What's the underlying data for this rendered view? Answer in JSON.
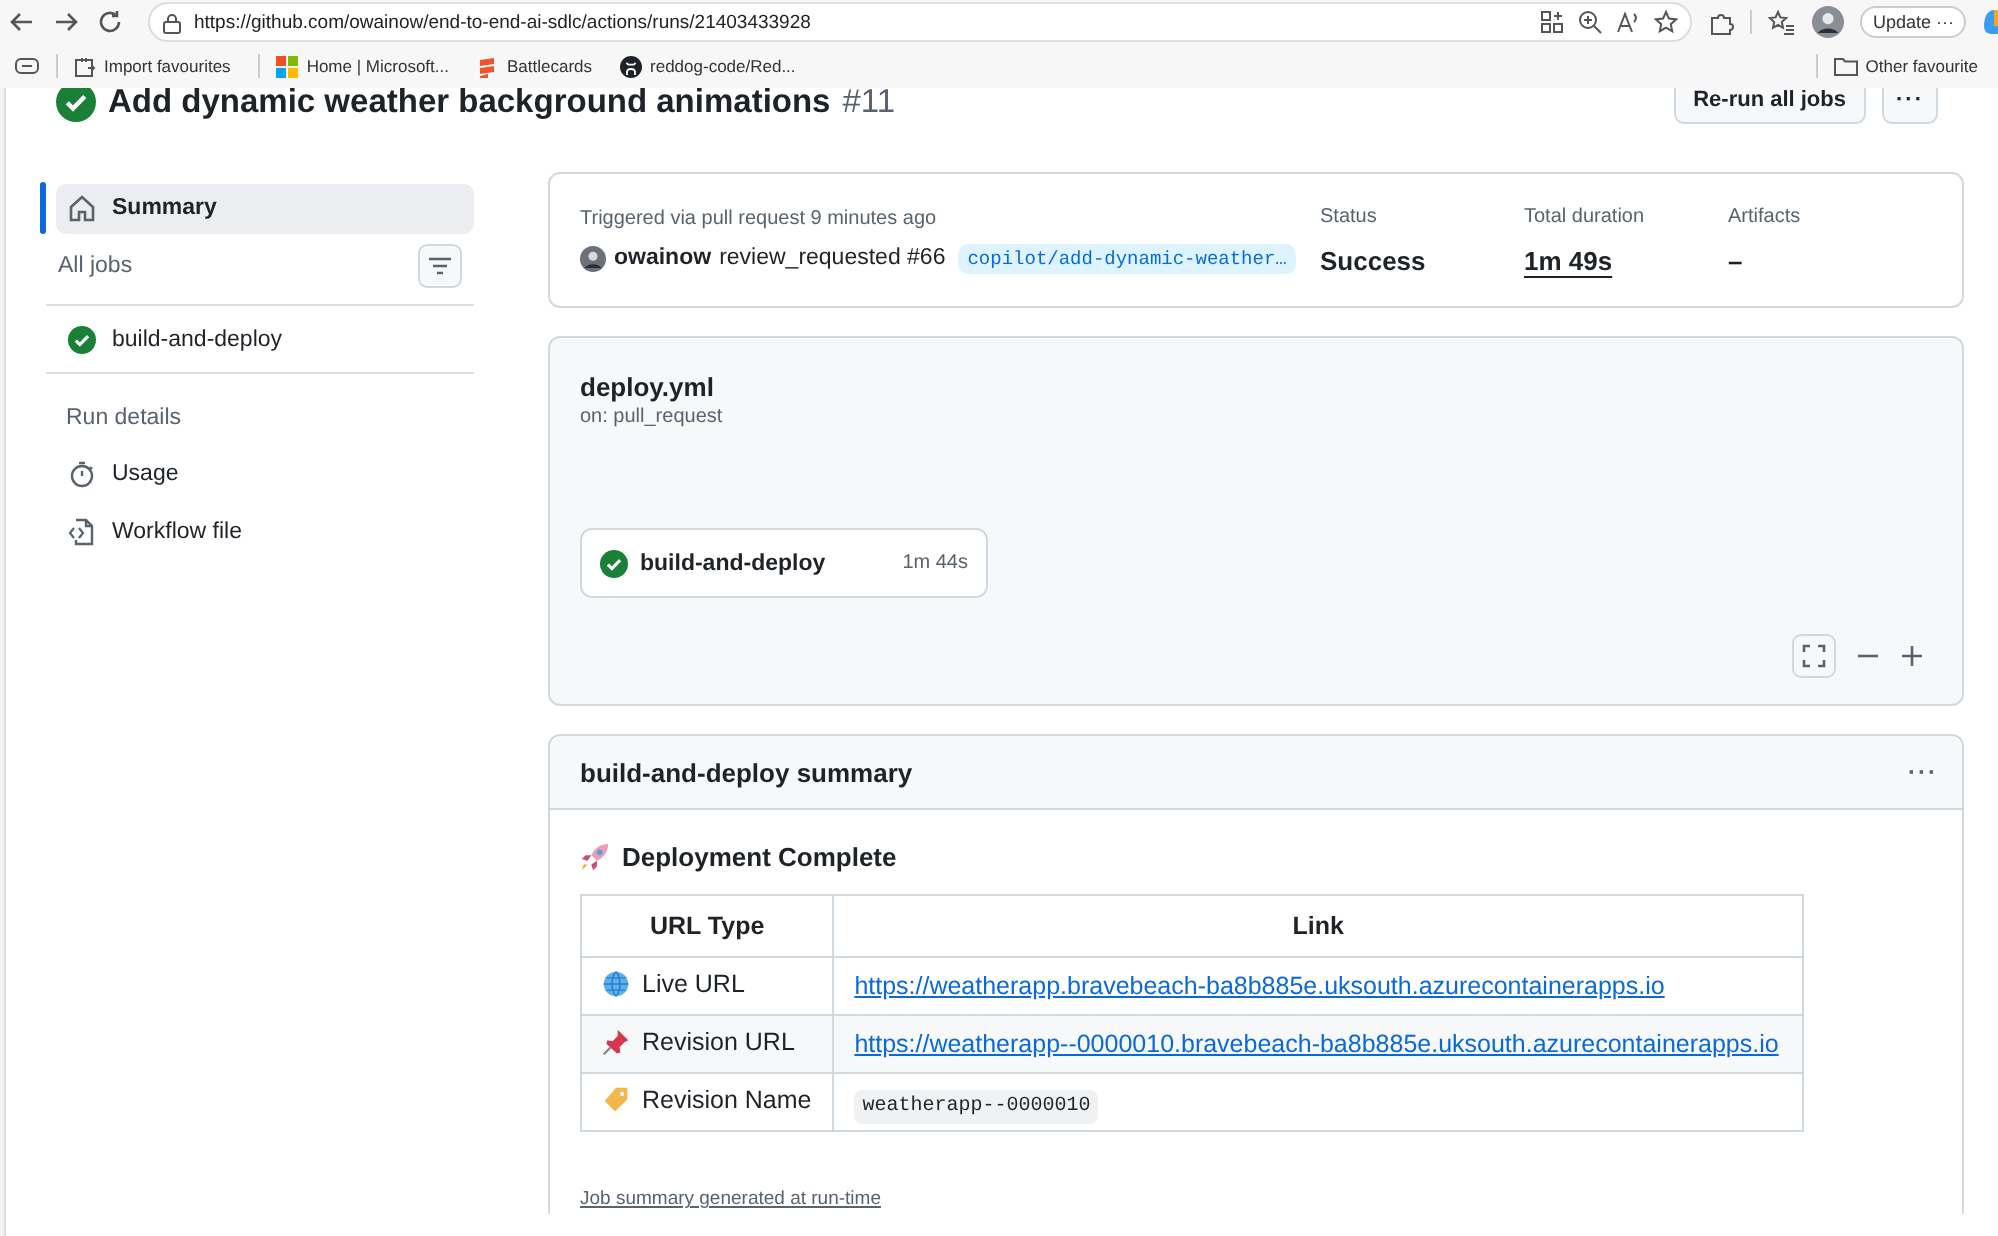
{
  "browser": {
    "url": "https://github.com/owainow/end-to-end-ai-sdlc/actions/runs/21403433928",
    "update_button": "Update ···",
    "bookmarks": [
      "Import favourites",
      "Home | Microsoft...",
      "Battlecards",
      "reddog-code/Red..."
    ],
    "other_favourites": "Other favourite"
  },
  "header": {
    "title": "Add dynamic weather background animations",
    "run_number": "#11",
    "rerun_button": "Re-run all jobs",
    "more_button": "···"
  },
  "sidebar": {
    "summary": {
      "label": "Summary",
      "selected": true
    },
    "all_jobs_label": "All jobs",
    "jobs": [
      {
        "label": "build-and-deploy",
        "selected": false
      }
    ],
    "run_details_label": "Run details",
    "details": [
      {
        "label": "Usage",
        "selected": false
      },
      {
        "label": "Workflow file",
        "selected": false
      }
    ]
  },
  "run_summary": {
    "trigger": "Triggered via pull request 9 minutes ago",
    "actor": "owainow",
    "event": "review_requested #66",
    "branch": "copilot/add-dynamic-weather…",
    "status_label": "Status",
    "status": "Success",
    "duration_label": "Total duration",
    "duration": "1m 49s",
    "artifacts_label": "Artifacts",
    "artifacts": "–"
  },
  "workflow": {
    "file": "deploy.yml",
    "trigger": "on: pull_request",
    "job": {
      "name": "build-and-deploy",
      "duration": "1m 44s"
    }
  },
  "job_summary": {
    "title": "build-and-deploy summary",
    "more_button": "···",
    "heading": "Deployment Complete",
    "columns": [
      "URL Type",
      "Link"
    ],
    "rows": [
      {
        "type": "Live URL",
        "kind": "link",
        "value": "https://weatherapp.bravebeach-ba8b885e.uksouth.azurecontainerapps.io"
      },
      {
        "type": "Revision URL",
        "kind": "link",
        "value": "https://weatherapp--0000010.bravebeach-ba8b885e.uksouth.azurecontainerapps.io"
      },
      {
        "type": "Revision Name",
        "kind": "code",
        "value": "weatherapp--0000010"
      }
    ],
    "footer": "Job summary generated at run-time"
  }
}
